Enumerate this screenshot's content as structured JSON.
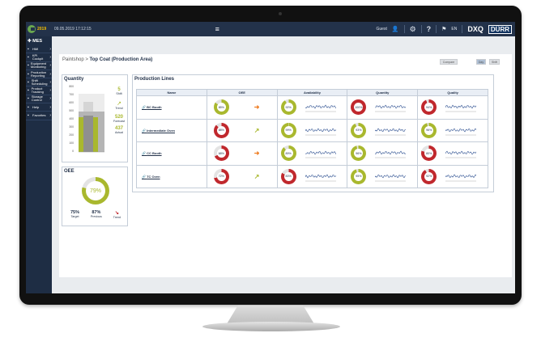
{
  "header": {
    "logo_text": "MES",
    "logo_year": "2019",
    "datetime": "09.05.2019 17:12:15",
    "user": "Guest",
    "lang": "EN",
    "brand1": "DXQ",
    "brand2": "DÜRR"
  },
  "sidebar": {
    "title": "MES",
    "items": [
      {
        "label": "HMI",
        "icon": "monitor-icon"
      },
      {
        "label": "KPI Cockpit",
        "icon": "grid-icon"
      },
      {
        "label": "Equipment Monitoring",
        "icon": "equipment-icon"
      },
      {
        "label": "Production Reporting",
        "icon": "report-icon"
      },
      {
        "label": "Shift Scheduling",
        "icon": "calendar-icon"
      },
      {
        "label": "Product Tracking",
        "icon": "tracking-icon"
      },
      {
        "label": "Storage Control",
        "icon": "storage-icon"
      },
      {
        "label": "Help",
        "icon": "help-icon"
      },
      {
        "label": "Favorites",
        "icon": "star-icon"
      }
    ]
  },
  "breadcrumb": {
    "parent": "Paintshop",
    "sep": " > ",
    "current": "Top Coat (Production Area)"
  },
  "buttons": {
    "compare": "Compare",
    "day": "Day",
    "shift": "Shift"
  },
  "quantity": {
    "title": "Quantity",
    "axis": [
      "800",
      "700",
      "600",
      "500",
      "400",
      "300",
      "200",
      "100",
      "0"
    ],
    "shift_value": "5",
    "shift_label": "Shift",
    "trend_label": "Trend",
    "forecast_value": "520",
    "forecast_label": "Forecast",
    "actual_value": "437",
    "actual_label": "Actual"
  },
  "oee_card": {
    "title": "OEE",
    "value": "79%",
    "percent": 79,
    "target_value": "75%",
    "target_label": "Target",
    "previous_value": "87%",
    "previous_label": "Previous",
    "trend_label": "Trend"
  },
  "production": {
    "title": "Production Lines",
    "headers": [
      "Name",
      "OEE",
      "Availability",
      "Quantity",
      "Quality"
    ],
    "rows": [
      {
        "name": "BC Booth",
        "oee": "85%",
        "oee_pct": 85,
        "oee_color": "#a9b82e",
        "trend": "right",
        "trend_color": "#ef7d22",
        "availability": "92%",
        "avail_pct": 92,
        "avail_color": "#a9b82e",
        "quantity": "100%",
        "qty_pct": 100,
        "qty_color": "#c0282d",
        "quality": "94%",
        "qual_pct": 94,
        "qual_color": "#c0282d"
      },
      {
        "name": "Intermediate Oven",
        "oee": "88%",
        "oee_pct": 88,
        "oee_color": "#c0282d",
        "trend": "up",
        "trend_color": "#a9b82e",
        "availability": "99%",
        "avail_pct": 99,
        "avail_color": "#a9b82e",
        "quantity": "93%",
        "qty_pct": 93,
        "qty_color": "#a9b82e",
        "quality": "96%",
        "qual_pct": 96,
        "qual_color": "#a9b82e"
      },
      {
        "name": "CC Booth",
        "oee": "68%",
        "oee_pct": 68,
        "oee_color": "#c0282d",
        "trend": "right",
        "trend_color": "#ef7d22",
        "availability": "89%",
        "avail_pct": 89,
        "avail_color": "#a9b82e",
        "quantity": "96%",
        "qty_pct": 96,
        "qty_color": "#a9b82e",
        "quality": "80%",
        "qual_pct": 80,
        "qual_color": "#c0282d"
      },
      {
        "name": "TC Oven",
        "oee": "72%",
        "oee_pct": 72,
        "oee_color": "#c0282d",
        "trend": "up",
        "trend_color": "#a9b82e",
        "availability": "83%",
        "avail_pct": 83,
        "avail_color": "#c0282d",
        "quantity": "95%",
        "qty_pct": 95,
        "qty_color": "#a9b82e",
        "quality": "92%",
        "qual_pct": 92,
        "qual_color": "#c0282d"
      }
    ]
  }
}
